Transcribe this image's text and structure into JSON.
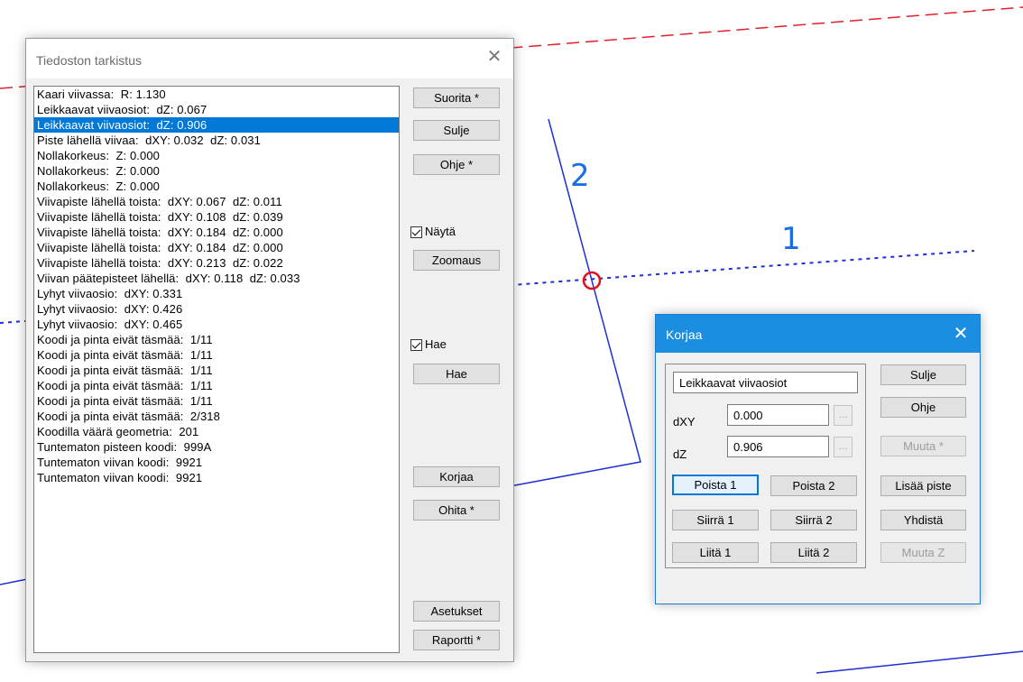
{
  "main_dialog": {
    "title": "Tiedoston tarkistus",
    "items": [
      "Kaari viivassa:  R: 1.130",
      "Leikkaavat viivaosiot:  dZ: 0.067",
      "Leikkaavat viivaosiot:  dZ: 0.906",
      "Piste lähellä viivaa:  dXY: 0.032  dZ: 0.031",
      "Nollakorkeus:  Z: 0.000",
      "Nollakorkeus:  Z: 0.000",
      "Nollakorkeus:  Z: 0.000",
      "Viivapiste lähellä toista:  dXY: 0.067  dZ: 0.011",
      "Viivapiste lähellä toista:  dXY: 0.108  dZ: 0.039",
      "Viivapiste lähellä toista:  dXY: 0.184  dZ: 0.000",
      "Viivapiste lähellä toista:  dXY: 0.184  dZ: 0.000",
      "Viivapiste lähellä toista:  dXY: 0.213  dZ: 0.022",
      "Viivan päätepisteet lähellä:  dXY: 0.118  dZ: 0.033",
      "Lyhyt viivaosio:  dXY: 0.331",
      "Lyhyt viivaosio:  dXY: 0.426",
      "Lyhyt viivaosio:  dXY: 0.465",
      "Koodi ja pinta eivät täsmää:  1/11",
      "Koodi ja pinta eivät täsmää:  1/11",
      "Koodi ja pinta eivät täsmää:  1/11",
      "Koodi ja pinta eivät täsmää:  1/11",
      "Koodi ja pinta eivät täsmää:  1/11",
      "Koodi ja pinta eivät täsmää:  2/318",
      "Koodilla väärä geometria:  201",
      "Tuntematon pisteen koodi:  999A",
      "Tuntematon viivan koodi:  9921",
      "Tuntematon viivan koodi:  9921"
    ],
    "selected_index": 2,
    "buttons": {
      "suorita": "Suorita *",
      "sulje": "Sulje",
      "ohje": "Ohje *",
      "zoomaus": "Zoomaus",
      "hae": "Hae",
      "korjaa": "Korjaa",
      "ohita": "Ohita *",
      "asetukset": "Asetukset",
      "raportti": "Raportti *"
    },
    "checkboxes": {
      "nayta": {
        "label": "Näytä",
        "checked": true
      },
      "hae": {
        "label": "Hae",
        "checked": true
      }
    }
  },
  "korjaa_dialog": {
    "title": "Korjaa",
    "issue_name": "Leikkaavat viivaosiot",
    "dxy_label": "dXY",
    "dxy_value": "0.000",
    "dz_label": "dZ",
    "dz_value": "0.906",
    "ellipsis": "...",
    "buttons": {
      "poista1": "Poista 1",
      "poista2": "Poista 2",
      "siirra1": "Siirrä 1",
      "siirra2": "Siirrä 2",
      "lita1": "Liitä 1",
      "lita2": "Liitä 2",
      "sulje": "Sulje",
      "ohje": "Ohje",
      "muuta": "Muuta *",
      "lisaa_piste": "Lisää piste",
      "yhdista": "Yhdistä",
      "muuta_z": "Muuta Z"
    }
  },
  "canvas": {
    "label_1": "1",
    "label_2": "2",
    "colors": {
      "blue_line": "#1f2fd6",
      "red_dash": "#e0202a",
      "label_blue": "#1a6fe0",
      "marker_red": "#e0101a"
    }
  }
}
